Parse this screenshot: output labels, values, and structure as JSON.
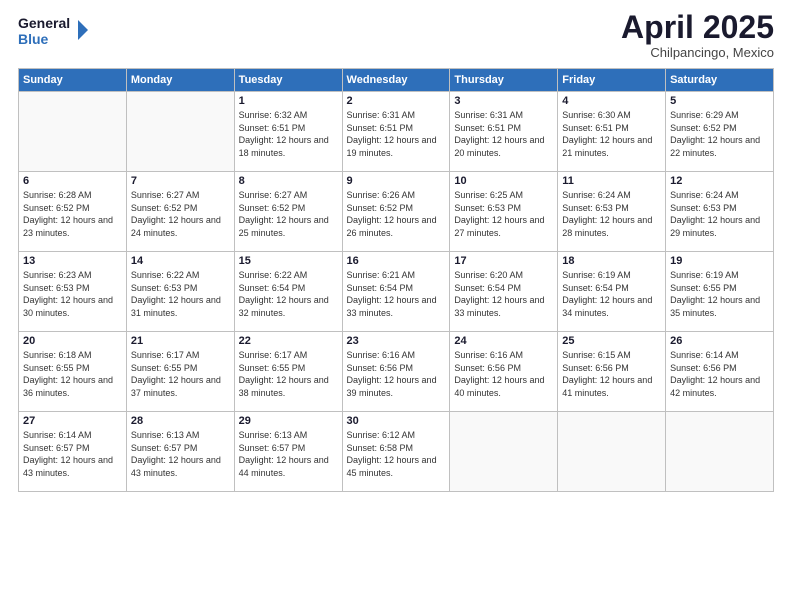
{
  "logo": {
    "line1": "General",
    "line2": "Blue"
  },
  "title": "April 2025",
  "subtitle": "Chilpancingo, Mexico",
  "days_header": [
    "Sunday",
    "Monday",
    "Tuesday",
    "Wednesday",
    "Thursday",
    "Friday",
    "Saturday"
  ],
  "weeks": [
    [
      {
        "day": "",
        "info": ""
      },
      {
        "day": "",
        "info": ""
      },
      {
        "day": "1",
        "info": "Sunrise: 6:32 AM\nSunset: 6:51 PM\nDaylight: 12 hours and 18 minutes."
      },
      {
        "day": "2",
        "info": "Sunrise: 6:31 AM\nSunset: 6:51 PM\nDaylight: 12 hours and 19 minutes."
      },
      {
        "day": "3",
        "info": "Sunrise: 6:31 AM\nSunset: 6:51 PM\nDaylight: 12 hours and 20 minutes."
      },
      {
        "day": "4",
        "info": "Sunrise: 6:30 AM\nSunset: 6:51 PM\nDaylight: 12 hours and 21 minutes."
      },
      {
        "day": "5",
        "info": "Sunrise: 6:29 AM\nSunset: 6:52 PM\nDaylight: 12 hours and 22 minutes."
      }
    ],
    [
      {
        "day": "6",
        "info": "Sunrise: 6:28 AM\nSunset: 6:52 PM\nDaylight: 12 hours and 23 minutes."
      },
      {
        "day": "7",
        "info": "Sunrise: 6:27 AM\nSunset: 6:52 PM\nDaylight: 12 hours and 24 minutes."
      },
      {
        "day": "8",
        "info": "Sunrise: 6:27 AM\nSunset: 6:52 PM\nDaylight: 12 hours and 25 minutes."
      },
      {
        "day": "9",
        "info": "Sunrise: 6:26 AM\nSunset: 6:52 PM\nDaylight: 12 hours and 26 minutes."
      },
      {
        "day": "10",
        "info": "Sunrise: 6:25 AM\nSunset: 6:53 PM\nDaylight: 12 hours and 27 minutes."
      },
      {
        "day": "11",
        "info": "Sunrise: 6:24 AM\nSunset: 6:53 PM\nDaylight: 12 hours and 28 minutes."
      },
      {
        "day": "12",
        "info": "Sunrise: 6:24 AM\nSunset: 6:53 PM\nDaylight: 12 hours and 29 minutes."
      }
    ],
    [
      {
        "day": "13",
        "info": "Sunrise: 6:23 AM\nSunset: 6:53 PM\nDaylight: 12 hours and 30 minutes."
      },
      {
        "day": "14",
        "info": "Sunrise: 6:22 AM\nSunset: 6:53 PM\nDaylight: 12 hours and 31 minutes."
      },
      {
        "day": "15",
        "info": "Sunrise: 6:22 AM\nSunset: 6:54 PM\nDaylight: 12 hours and 32 minutes."
      },
      {
        "day": "16",
        "info": "Sunrise: 6:21 AM\nSunset: 6:54 PM\nDaylight: 12 hours and 33 minutes."
      },
      {
        "day": "17",
        "info": "Sunrise: 6:20 AM\nSunset: 6:54 PM\nDaylight: 12 hours and 33 minutes."
      },
      {
        "day": "18",
        "info": "Sunrise: 6:19 AM\nSunset: 6:54 PM\nDaylight: 12 hours and 34 minutes."
      },
      {
        "day": "19",
        "info": "Sunrise: 6:19 AM\nSunset: 6:55 PM\nDaylight: 12 hours and 35 minutes."
      }
    ],
    [
      {
        "day": "20",
        "info": "Sunrise: 6:18 AM\nSunset: 6:55 PM\nDaylight: 12 hours and 36 minutes."
      },
      {
        "day": "21",
        "info": "Sunrise: 6:17 AM\nSunset: 6:55 PM\nDaylight: 12 hours and 37 minutes."
      },
      {
        "day": "22",
        "info": "Sunrise: 6:17 AM\nSunset: 6:55 PM\nDaylight: 12 hours and 38 minutes."
      },
      {
        "day": "23",
        "info": "Sunrise: 6:16 AM\nSunset: 6:56 PM\nDaylight: 12 hours and 39 minutes."
      },
      {
        "day": "24",
        "info": "Sunrise: 6:16 AM\nSunset: 6:56 PM\nDaylight: 12 hours and 40 minutes."
      },
      {
        "day": "25",
        "info": "Sunrise: 6:15 AM\nSunset: 6:56 PM\nDaylight: 12 hours and 41 minutes."
      },
      {
        "day": "26",
        "info": "Sunrise: 6:14 AM\nSunset: 6:56 PM\nDaylight: 12 hours and 42 minutes."
      }
    ],
    [
      {
        "day": "27",
        "info": "Sunrise: 6:14 AM\nSunset: 6:57 PM\nDaylight: 12 hours and 43 minutes."
      },
      {
        "day": "28",
        "info": "Sunrise: 6:13 AM\nSunset: 6:57 PM\nDaylight: 12 hours and 43 minutes."
      },
      {
        "day": "29",
        "info": "Sunrise: 6:13 AM\nSunset: 6:57 PM\nDaylight: 12 hours and 44 minutes."
      },
      {
        "day": "30",
        "info": "Sunrise: 6:12 AM\nSunset: 6:58 PM\nDaylight: 12 hours and 45 minutes."
      },
      {
        "day": "",
        "info": ""
      },
      {
        "day": "",
        "info": ""
      },
      {
        "day": "",
        "info": ""
      }
    ]
  ]
}
